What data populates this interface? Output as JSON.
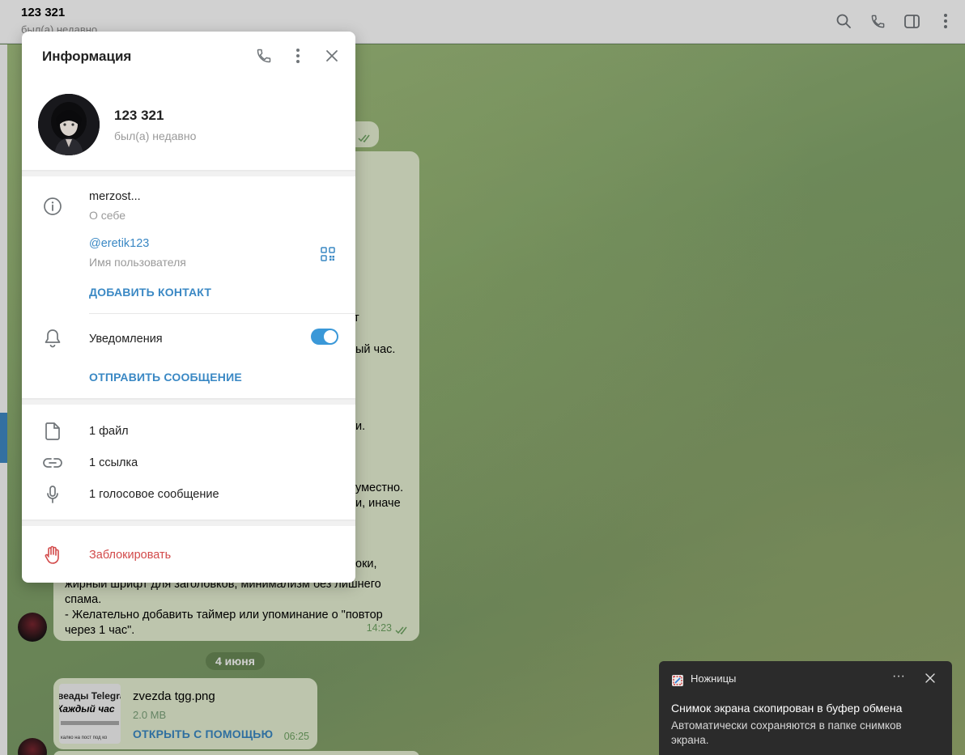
{
  "header": {
    "title": "123 321",
    "status": "был(а) недавно",
    "icons": [
      "search-icon",
      "phone-icon",
      "sidebar-toggle-icon",
      "more-vertical-icon"
    ]
  },
  "chat": {
    "fragments": [
      "т",
      "ый час.",
      "и.",
      "уместно.",
      "и, иначе",
      "оки,"
    ],
    "message_tail": "жирный шрифт для заголовков, минимализм без лишнего спама.\n- Желательно добавить таймер или упоминание о \"повтор через 1 час\".",
    "message_time": "14:23",
    "date_separator": "4 июня",
    "file": {
      "name": "zvezda tgg.png",
      "size": "2.0 MB",
      "open_label": "ОТКРЫТЬ С ПОМОЩЬЮ",
      "time": "06:25",
      "thumb_line1": "веады Telegra",
      "thumb_line2": "Каждый час",
      "thumb_line3": "калко на пост под ко"
    }
  },
  "panel": {
    "title": "Информация",
    "name": "123 321",
    "status": "был(а) недавно",
    "bio": "merzost...",
    "bio_label": "О себе",
    "username": "@eretik123",
    "username_label": "Имя пользователя",
    "add_contact": "ДОБАВИТЬ КОНТАКТ",
    "notifications_label": "Уведомления",
    "notifications_on": true,
    "send_message": "ОТПРАВИТЬ СООБЩЕНИЕ",
    "media": {
      "files": "1 файл",
      "links": "1 ссылка",
      "voice": "1 голосовое сообщение"
    },
    "block": "Заблокировать"
  },
  "toast": {
    "app": "Ножницы",
    "more": "···",
    "title": "Снимок экрана скопирован в буфер обмена",
    "body": "Автоматически сохраняются в папке снимков экрана."
  },
  "colors": {
    "accent": "#3a88c4",
    "danger": "#d24a4a",
    "toggle": "#3a98d8",
    "bubble": "#e7f1d3"
  }
}
